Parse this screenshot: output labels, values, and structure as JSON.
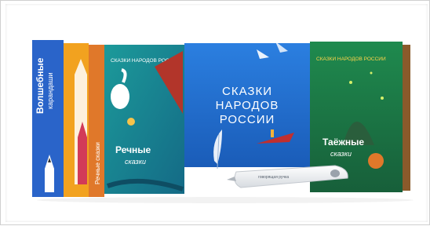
{
  "books": {
    "left_box": {
      "title": "Волшебные",
      "subtitle": "карандаши"
    },
    "river": {
      "spine": "Речные сказки",
      "cover_title": "Речные",
      "cover_sub": "сказки",
      "series": "СКАЗКИ НАРОДОВ РОССИИ"
    },
    "main": {
      "line1": "СКАЗКИ",
      "line2": "НАРОДОВ",
      "line3": "РОССИИ"
    },
    "taiga": {
      "series": "СКАЗКИ НАРОДОВ РОССИИ",
      "cover_title": "Таёжные",
      "cover_sub": "сказки"
    }
  },
  "pen": {
    "label": "говорящая ручка"
  },
  "colors": {
    "blue_cover": "#1f6fd0",
    "blue_light": "#3a8be8",
    "teal_cover": "#1a8a8a",
    "green_cover": "#1f7a4a",
    "orange_spine": "#e0782a"
  }
}
